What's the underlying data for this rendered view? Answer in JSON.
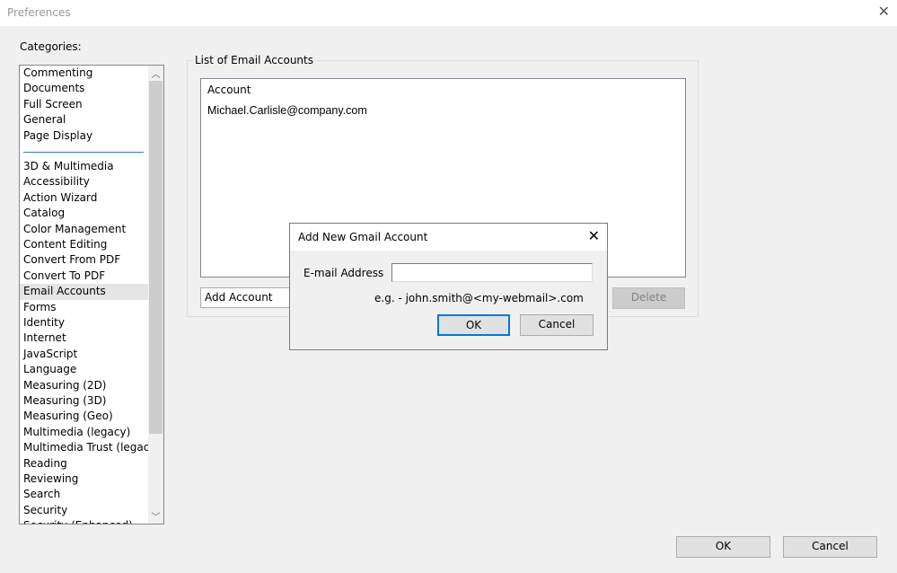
{
  "window": {
    "title": "Preferences",
    "close_icon": "close-icon"
  },
  "categories": {
    "label": "Categories:",
    "group1": [
      "Commenting",
      "Documents",
      "Full Screen",
      "General",
      "Page Display"
    ],
    "group2": [
      "3D & Multimedia",
      "Accessibility",
      "Action Wizard",
      "Catalog",
      "Color Management",
      "Content Editing",
      "Convert From PDF",
      "Convert To PDF",
      "Email Accounts",
      "Forms",
      "Identity",
      "Internet",
      "JavaScript",
      "Language",
      "Measuring (2D)",
      "Measuring (3D)",
      "Measuring (Geo)",
      "Multimedia (legacy)",
      "Multimedia Trust (legacy)",
      "Reading",
      "Reviewing",
      "Search",
      "Security",
      "Security (Enhanced)"
    ],
    "selected": "Email Accounts"
  },
  "email_accounts": {
    "group_label": "List of Email Accounts",
    "column_header": "Account",
    "accounts": [
      "Michael.Carlisle@company.com"
    ],
    "add_label": "Add Account",
    "delete_label": "Delete"
  },
  "dialog": {
    "title": "Add New Gmail Account",
    "email_label": "E-mail Address",
    "email_value": "",
    "hint": "e.g. - john.smith@<my-webmail>.com",
    "ok_label": "OK",
    "cancel_label": "Cancel"
  },
  "footer": {
    "ok_label": "OK",
    "cancel_label": "Cancel"
  },
  "colors": {
    "accent": "#0078d7",
    "separator": "#3c7fc1"
  }
}
